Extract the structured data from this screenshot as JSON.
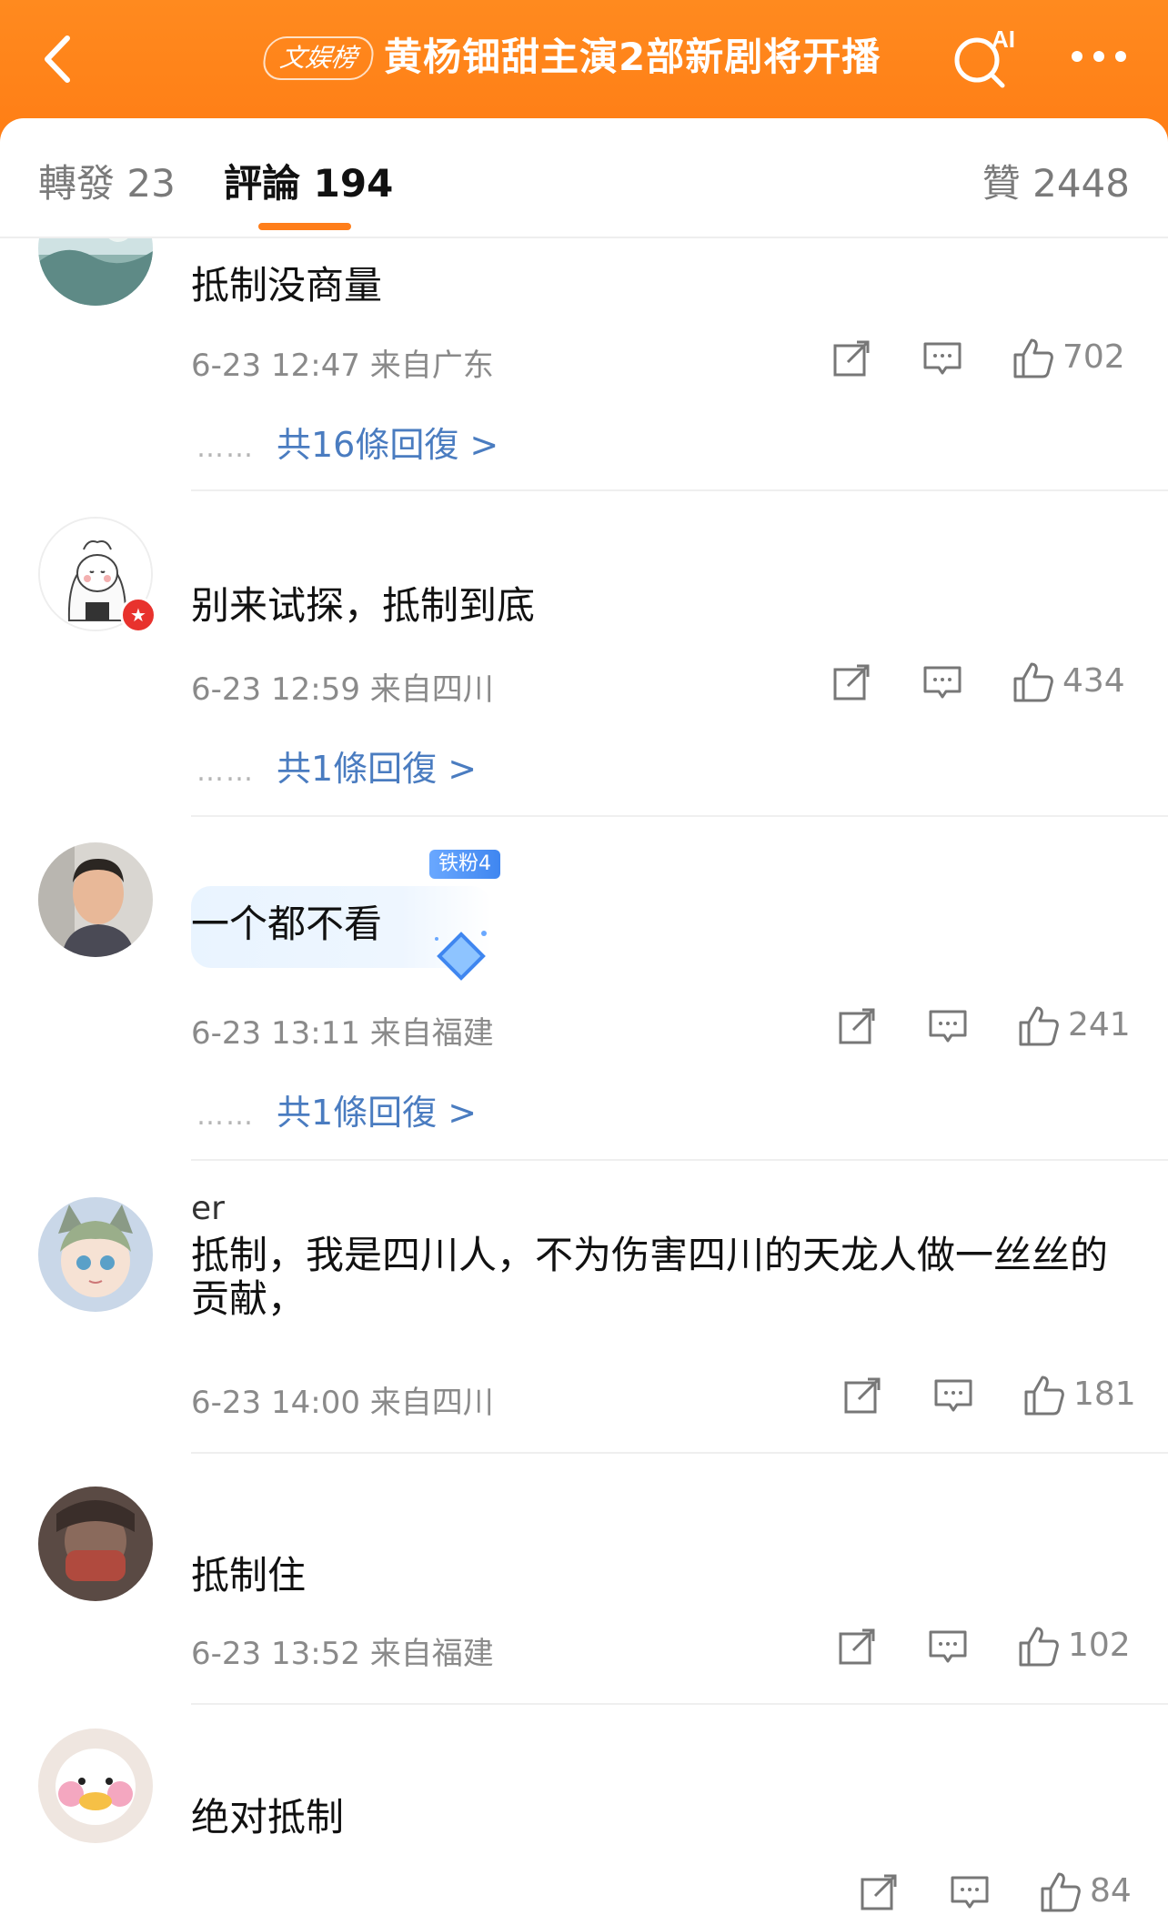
{
  "header": {
    "badge": "文娱榜",
    "title": "黄杨钿甜主演2部新剧将开播",
    "ai_label": "AI"
  },
  "tabs": {
    "repost": "轉發 23",
    "comment": "評論 194",
    "like": "贊 2448"
  },
  "colors": {
    "header": "#ff7e1a",
    "accent": "#ff7e1a",
    "link": "#4a7cc0",
    "meta": "#8a8a8a"
  },
  "comments": [
    {
      "username": "",
      "text": "抵制没商量",
      "meta": "6-23 12:47 来自广东",
      "likes": "702",
      "replies": "共16條回復 >"
    },
    {
      "username": "",
      "text": "别来试探，抵制到底",
      "meta": "6-23 12:59 来自四川",
      "likes": "434",
      "replies": "共1條回復 >"
    },
    {
      "username": "",
      "fan_badge": "铁粉4",
      "text": "一个都不看",
      "meta": "6-23 13:11 来自福建",
      "likes": "241",
      "replies": "共1條回復 >"
    },
    {
      "username": "er",
      "text": "抵制，我是四川人，不为伤害四川的天龙人做一丝丝的贡献，",
      "meta": "6-23 14:00 来自四川",
      "likes": "181"
    },
    {
      "username": "",
      "text": "抵制住",
      "meta": "6-23 13:52 来自福建",
      "likes": "102"
    },
    {
      "username": "",
      "text": "绝对抵制",
      "meta": "",
      "likes": "84"
    }
  ],
  "reply_dots": "……",
  "icons": [
    "back-arrow-icon",
    "ai-search-icon",
    "more-dots-icon",
    "share-icon",
    "comment-icon",
    "like-icon"
  ]
}
